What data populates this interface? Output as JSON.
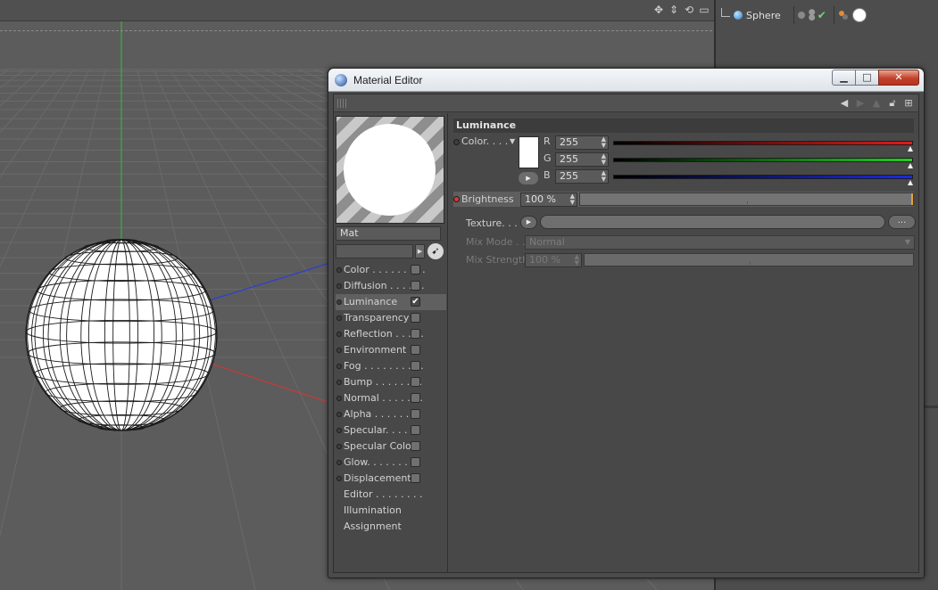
{
  "object_manager": {
    "object_name": "Sphere"
  },
  "material_editor": {
    "window_title": "Material Editor",
    "material_name": "Mat",
    "channels": [
      {
        "label": "Color . . . . . . . . .",
        "checked": false,
        "has_checkbox": true,
        "has_dot": true
      },
      {
        "label": "Diffusion . . . . . .",
        "checked": false,
        "has_checkbox": true,
        "has_dot": true
      },
      {
        "label": "Luminance",
        "checked": true,
        "has_checkbox": true,
        "has_dot": true,
        "selected": true
      },
      {
        "label": "Transparency",
        "checked": false,
        "has_checkbox": true,
        "has_dot": true
      },
      {
        "label": "Reflection . . . . .",
        "checked": false,
        "has_checkbox": true,
        "has_dot": true
      },
      {
        "label": "Environment",
        "checked": false,
        "has_checkbox": true,
        "has_dot": true
      },
      {
        "label": "Fog . . . . . . . . . .",
        "checked": false,
        "has_checkbox": true,
        "has_dot": true
      },
      {
        "label": "Bump . . . . . . . .",
        "checked": false,
        "has_checkbox": true,
        "has_dot": true
      },
      {
        "label": "Normal . . . . . . .",
        "checked": false,
        "has_checkbox": true,
        "has_dot": true
      },
      {
        "label": "Alpha . . . . . . . .",
        "checked": false,
        "has_checkbox": true,
        "has_dot": true
      },
      {
        "label": "Specular. . . . . .",
        "checked": false,
        "has_checkbox": true,
        "has_dot": true
      },
      {
        "label": "Specular Color",
        "checked": false,
        "has_checkbox": true,
        "has_dot": true
      },
      {
        "label": "Glow. . . . . . . . .",
        "checked": false,
        "has_checkbox": true,
        "has_dot": true
      },
      {
        "label": "Displacement",
        "checked": false,
        "has_checkbox": true,
        "has_dot": true
      },
      {
        "label": "Editor . . . . . . . .",
        "has_checkbox": false,
        "has_dot": false
      },
      {
        "label": "Illumination",
        "has_checkbox": false,
        "has_dot": false
      },
      {
        "label": "Assignment",
        "has_checkbox": false,
        "has_dot": false
      }
    ],
    "section_title": "Luminance",
    "color_label": "Color. . . .",
    "r_label": "R",
    "g_label": "G",
    "b_label": "B",
    "r_value": "255",
    "g_value": "255",
    "b_value": "255",
    "brightness_label": "Brightness",
    "brightness_value": "100 %",
    "texture_label": "Texture. . . .",
    "texture_more": "...",
    "mix_mode_label": "Mix Mode . .",
    "mix_mode_value": "Normal",
    "mix_strength_label": "Mix Strength",
    "mix_strength_value": "100 %"
  }
}
